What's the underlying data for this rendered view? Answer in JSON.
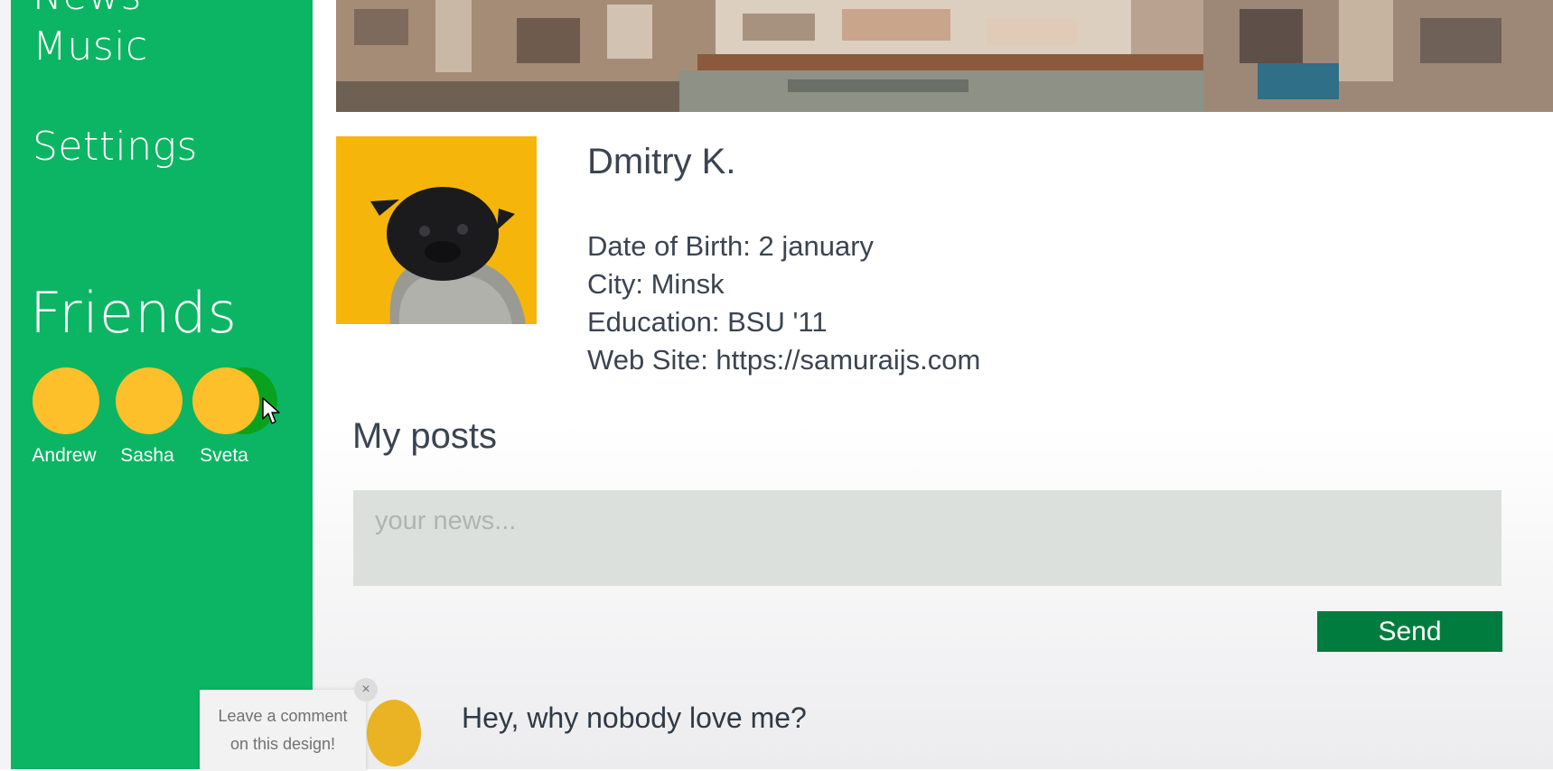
{
  "sidebar": {
    "nav": {
      "news": "News",
      "music": "Music",
      "settings": "Settings"
    },
    "friends_title": "Friends",
    "friends": [
      {
        "name": "Andrew"
      },
      {
        "name": "Sasha"
      },
      {
        "name": "Sveta"
      }
    ]
  },
  "profile": {
    "name": "Dmitry K.",
    "date_of_birth": "Date of Birth: 2 january",
    "city": "City: Minsk",
    "education": "Education: BSU '11",
    "website": "Web Site: https://samuraijs.com"
  },
  "posts": {
    "title": "My posts",
    "input_placeholder": "your news...",
    "send_label": "Send",
    "items": [
      {
        "text": "Hey, why nobody love me?"
      }
    ]
  },
  "comment_widget": {
    "line1": "Leave a comment",
    "line2": "on this design!",
    "close": "×"
  },
  "colors": {
    "sidebar": "#0bb563",
    "friend_avatar": "#fdc02b",
    "send_button": "#007d3e",
    "photo_bg": "#f5b50b"
  }
}
